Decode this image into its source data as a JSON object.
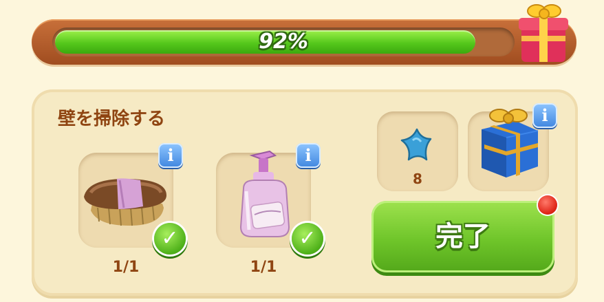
{
  "progress": {
    "percent_label": "92%",
    "fraction": 0.92
  },
  "task": {
    "title": "壁を掃除する",
    "items": [
      {
        "icon": "brush-icon",
        "count_label": "1/1",
        "completed": true,
        "info_label": "i"
      },
      {
        "icon": "soap-bottle-icon",
        "count_label": "1/1",
        "completed": true,
        "info_label": "i"
      }
    ]
  },
  "rewards": {
    "star_count": "8",
    "gift_info_label": "i"
  },
  "actions": {
    "done_label": "完了"
  },
  "colors": {
    "progress_fill": "#55c81c",
    "title_text": "#8f4512",
    "done_button": "#6fc52a",
    "notification": "#e0261a"
  }
}
